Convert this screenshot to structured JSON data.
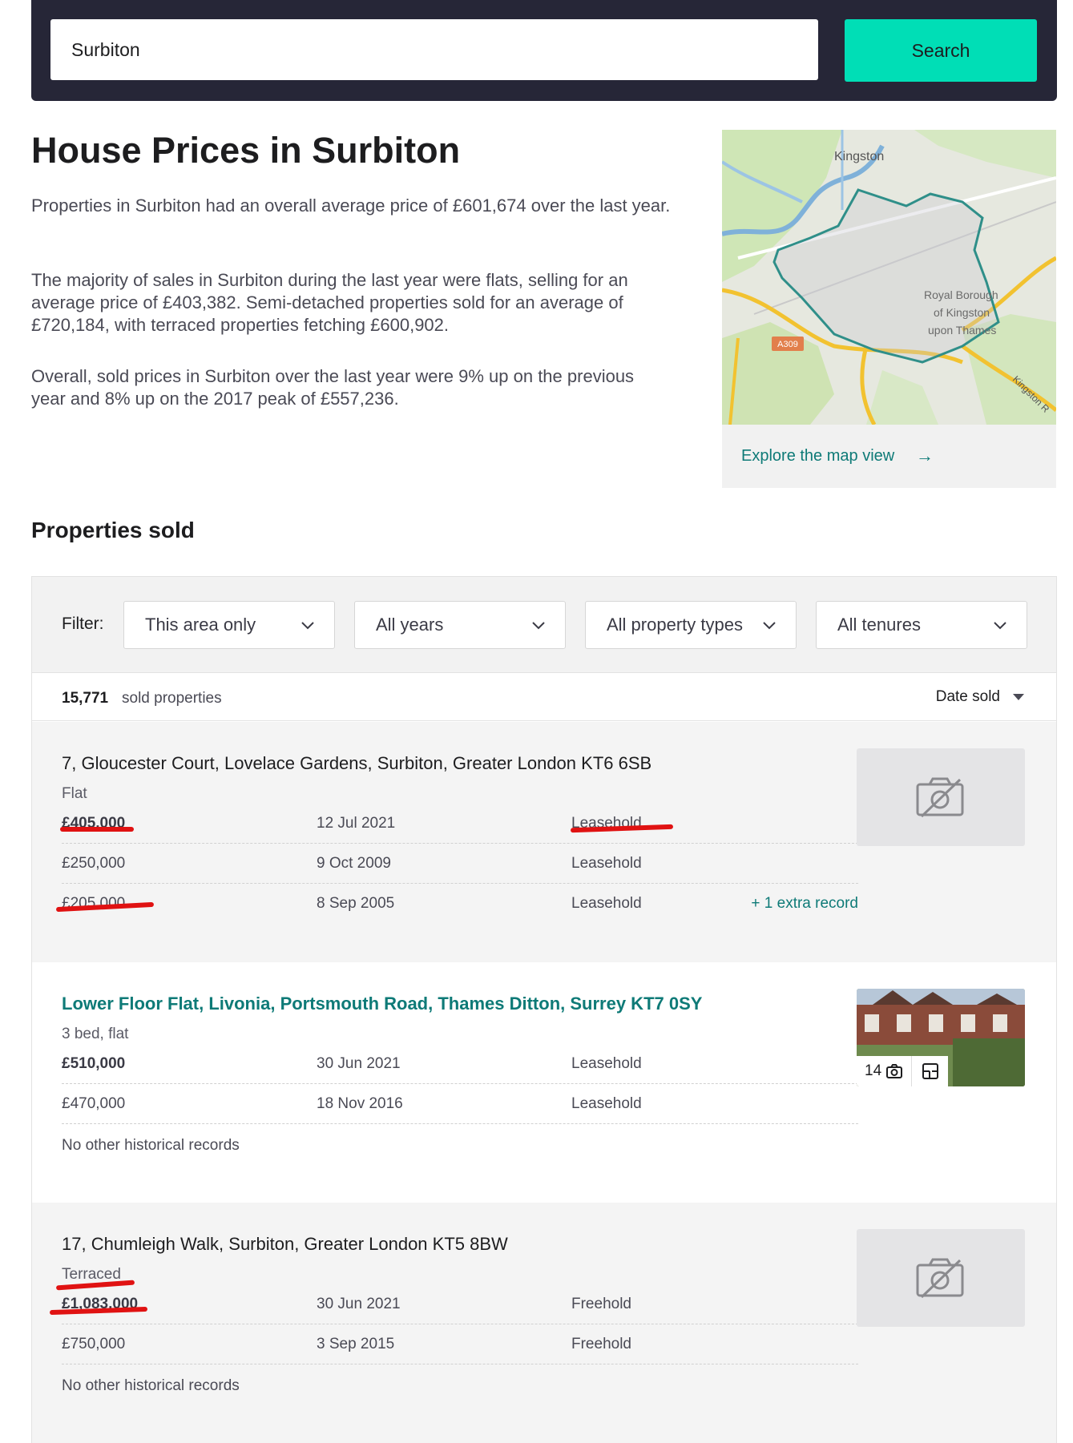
{
  "search": {
    "value": "Surbiton",
    "button_label": "Search"
  },
  "intro": {
    "title": "House Prices in Surbiton",
    "paragraphs": [
      "Properties in Surbiton had an overall average price of £601,674 over the last year.",
      "The majority of sales in Surbiton during the last year were flats, selling for an average price of £403,382. Semi-detached properties sold for an average of £720,184, with terraced properties fetching £600,902.",
      "Overall, sold prices in Surbiton over the last year were 9% up on the previous year and 8% up on the 2017 peak of £557,236."
    ]
  },
  "map": {
    "labels": {
      "town": "Kingston",
      "borough_1": "Royal Borough",
      "borough_2": "of Kingston",
      "borough_3": "upon Thames",
      "road": "A309",
      "road_2": "Kingston R"
    },
    "link_label": "Explore the map view",
    "arrow_icon": "arrow-right-icon"
  },
  "sold": {
    "title": "Properties sold",
    "filter_label": "Filter:",
    "filters": [
      "This area only",
      "All years",
      "All property types",
      "All tenures"
    ],
    "count": "15,771",
    "count_label": "sold properties",
    "sort_label": "Date sold",
    "listings": [
      {
        "address": "7, Gloucester Court, Lovelace Gardens, Surbiton, Greater London KT6 6SB",
        "type": "Flat",
        "records": [
          {
            "price": "£405,000",
            "date": "12 Jul 2021",
            "tenure": "Leasehold"
          },
          {
            "price": "£250,000",
            "date": "9 Oct 2009",
            "tenure": "Leasehold"
          },
          {
            "price": "£205,000",
            "date": "8 Sep 2005",
            "tenure": "Leasehold",
            "extra": "+ 1 extra record"
          }
        ],
        "image": "no-photo-icon"
      },
      {
        "address": "Lower Floor Flat, Livonia, Portsmouth Road, Thames Ditton, Surrey KT7 0SY",
        "type": "3 bed, flat",
        "records": [
          {
            "price": "£510,000",
            "date": "30 Jun 2021",
            "tenure": "Leasehold"
          },
          {
            "price": "£470,000",
            "date": "18 Nov 2016",
            "tenure": "Leasehold"
          }
        ],
        "note": "No other historical records",
        "photo_count": "14"
      },
      {
        "address": "17, Chumleigh Walk, Surbiton, Greater London KT5 8BW",
        "type": "Terraced",
        "records": [
          {
            "price": "£1,083,000",
            "date": "30 Jun 2021",
            "tenure": "Freehold"
          },
          {
            "price": "£750,000",
            "date": "3 Sep 2015",
            "tenure": "Freehold"
          }
        ],
        "note": "No other historical records",
        "image": "no-photo-icon"
      }
    ]
  },
  "colors": {
    "header": "#262637",
    "accent": "#00deb6",
    "link": "#0e7a77",
    "annotation": "#e01212"
  }
}
